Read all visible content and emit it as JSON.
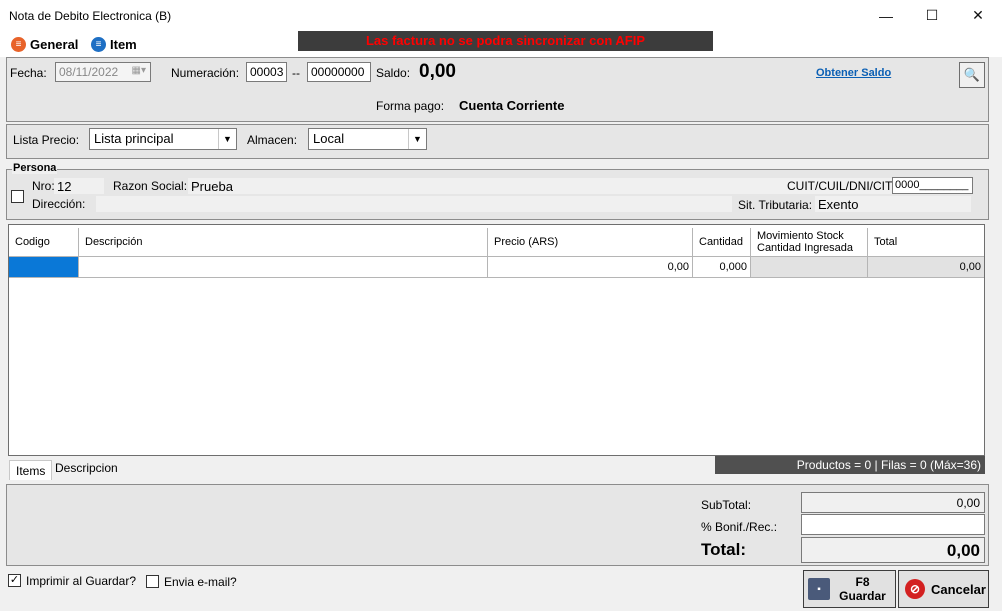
{
  "window": {
    "title": "Nota de Debito Electronica (B)",
    "minimize_glyph": "—",
    "maximize_glyph": "☐",
    "close_glyph": "✕"
  },
  "menu": {
    "general_label": "General",
    "item_label": "Item"
  },
  "banner": {
    "text": "Las factura no se podra sincronizar con AFIP",
    "color": "#ff0000"
  },
  "header": {
    "fecha_label": "Fecha:",
    "fecha_value": "08/11/2022",
    "numeracion_label": "Numeración:",
    "numeracion_prefix": "00003",
    "numeracion_sep": "--",
    "numeracion_number": "00000000",
    "saldo_label": "Saldo:",
    "saldo_value": "0,00",
    "obtener_saldo_link": "Obtener Saldo",
    "forma_pago_label": "Forma pago:",
    "forma_pago_value": "Cuenta Corriente"
  },
  "lista": {
    "lista_precio_label": "Lista Precio:",
    "lista_precio_value": "Lista principal",
    "almacen_label": "Almacen:",
    "almacen_value": "Local"
  },
  "persona": {
    "group_label": "Persona",
    "nro_label": "Nro:",
    "nro_value": "12",
    "razon_social_label": "Razon Social:",
    "razon_social_value": "Prueba",
    "cuit_label": "CUIT/CUIL/DNI/CIT:",
    "cuit_value": "0000________",
    "direccion_label": "Dirección:",
    "direccion_value": "",
    "sit_tributaria_label": "Sit. Tributaria:",
    "sit_tributaria_value": "Exento"
  },
  "grid": {
    "columns": [
      "Codigo",
      "Descripción",
      "Precio (ARS)",
      "Cantidad",
      "Movimiento Stock",
      "Cantidad Ingresada",
      "Total"
    ],
    "rows": [
      {
        "codigo": "",
        "descripcion": "",
        "precio": "0,00",
        "cantidad": "0,000",
        "movimiento": "",
        "total": "0,00"
      }
    ],
    "selected_color": "#0a78d7"
  },
  "tabs": [
    "Items",
    "Descripcion"
  ],
  "status": {
    "text": "Productos = 0 | Filas = 0 (Máx=36)"
  },
  "totals": {
    "subtotal_label": "SubTotal:",
    "subtotal_value": "0,00",
    "bonif_label": "% Bonif./Rec.:",
    "bonif_value": "",
    "total_label": "Total:",
    "total_value": "0,00"
  },
  "footer": {
    "imprimir_label": "Imprimir al Guardar?",
    "imprimir_checked": true,
    "email_label": "Envia e-mail?",
    "email_checked": false,
    "guardar_key": "F8",
    "guardar_label": "Guardar",
    "cancelar_label": "Cancelar"
  },
  "icons": {
    "general": "list-circle-icon",
    "item": "list-circle-icon",
    "calendar": "calendar-icon",
    "person": "person-lookup-icon",
    "save": "floppy-disk-icon",
    "cancel": "cancel-circle-icon"
  }
}
